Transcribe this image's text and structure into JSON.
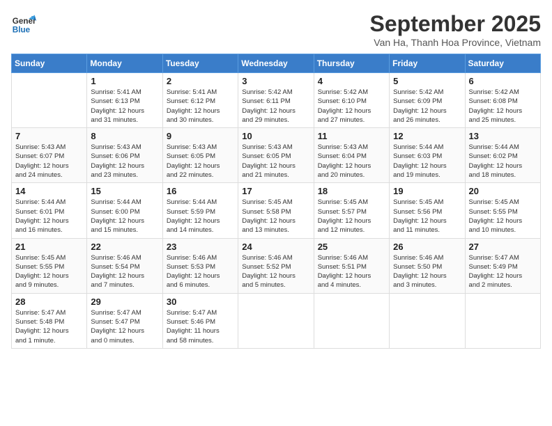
{
  "header": {
    "logo_line1": "General",
    "logo_line2": "Blue",
    "month": "September 2025",
    "location": "Van Ha, Thanh Hoa Province, Vietnam"
  },
  "weekdays": [
    "Sunday",
    "Monday",
    "Tuesday",
    "Wednesday",
    "Thursday",
    "Friday",
    "Saturday"
  ],
  "weeks": [
    [
      {
        "day": "",
        "info": ""
      },
      {
        "day": "1",
        "info": "Sunrise: 5:41 AM\nSunset: 6:13 PM\nDaylight: 12 hours\nand 31 minutes."
      },
      {
        "day": "2",
        "info": "Sunrise: 5:41 AM\nSunset: 6:12 PM\nDaylight: 12 hours\nand 30 minutes."
      },
      {
        "day": "3",
        "info": "Sunrise: 5:42 AM\nSunset: 6:11 PM\nDaylight: 12 hours\nand 29 minutes."
      },
      {
        "day": "4",
        "info": "Sunrise: 5:42 AM\nSunset: 6:10 PM\nDaylight: 12 hours\nand 27 minutes."
      },
      {
        "day": "5",
        "info": "Sunrise: 5:42 AM\nSunset: 6:09 PM\nDaylight: 12 hours\nand 26 minutes."
      },
      {
        "day": "6",
        "info": "Sunrise: 5:42 AM\nSunset: 6:08 PM\nDaylight: 12 hours\nand 25 minutes."
      }
    ],
    [
      {
        "day": "7",
        "info": "Sunrise: 5:43 AM\nSunset: 6:07 PM\nDaylight: 12 hours\nand 24 minutes."
      },
      {
        "day": "8",
        "info": "Sunrise: 5:43 AM\nSunset: 6:06 PM\nDaylight: 12 hours\nand 23 minutes."
      },
      {
        "day": "9",
        "info": "Sunrise: 5:43 AM\nSunset: 6:05 PM\nDaylight: 12 hours\nand 22 minutes."
      },
      {
        "day": "10",
        "info": "Sunrise: 5:43 AM\nSunset: 6:05 PM\nDaylight: 12 hours\nand 21 minutes."
      },
      {
        "day": "11",
        "info": "Sunrise: 5:43 AM\nSunset: 6:04 PM\nDaylight: 12 hours\nand 20 minutes."
      },
      {
        "day": "12",
        "info": "Sunrise: 5:44 AM\nSunset: 6:03 PM\nDaylight: 12 hours\nand 19 minutes."
      },
      {
        "day": "13",
        "info": "Sunrise: 5:44 AM\nSunset: 6:02 PM\nDaylight: 12 hours\nand 18 minutes."
      }
    ],
    [
      {
        "day": "14",
        "info": "Sunrise: 5:44 AM\nSunset: 6:01 PM\nDaylight: 12 hours\nand 16 minutes."
      },
      {
        "day": "15",
        "info": "Sunrise: 5:44 AM\nSunset: 6:00 PM\nDaylight: 12 hours\nand 15 minutes."
      },
      {
        "day": "16",
        "info": "Sunrise: 5:44 AM\nSunset: 5:59 PM\nDaylight: 12 hours\nand 14 minutes."
      },
      {
        "day": "17",
        "info": "Sunrise: 5:45 AM\nSunset: 5:58 PM\nDaylight: 12 hours\nand 13 minutes."
      },
      {
        "day": "18",
        "info": "Sunrise: 5:45 AM\nSunset: 5:57 PM\nDaylight: 12 hours\nand 12 minutes."
      },
      {
        "day": "19",
        "info": "Sunrise: 5:45 AM\nSunset: 5:56 PM\nDaylight: 12 hours\nand 11 minutes."
      },
      {
        "day": "20",
        "info": "Sunrise: 5:45 AM\nSunset: 5:55 PM\nDaylight: 12 hours\nand 10 minutes."
      }
    ],
    [
      {
        "day": "21",
        "info": "Sunrise: 5:45 AM\nSunset: 5:55 PM\nDaylight: 12 hours\nand 9 minutes."
      },
      {
        "day": "22",
        "info": "Sunrise: 5:46 AM\nSunset: 5:54 PM\nDaylight: 12 hours\nand 7 minutes."
      },
      {
        "day": "23",
        "info": "Sunrise: 5:46 AM\nSunset: 5:53 PM\nDaylight: 12 hours\nand 6 minutes."
      },
      {
        "day": "24",
        "info": "Sunrise: 5:46 AM\nSunset: 5:52 PM\nDaylight: 12 hours\nand 5 minutes."
      },
      {
        "day": "25",
        "info": "Sunrise: 5:46 AM\nSunset: 5:51 PM\nDaylight: 12 hours\nand 4 minutes."
      },
      {
        "day": "26",
        "info": "Sunrise: 5:46 AM\nSunset: 5:50 PM\nDaylight: 12 hours\nand 3 minutes."
      },
      {
        "day": "27",
        "info": "Sunrise: 5:47 AM\nSunset: 5:49 PM\nDaylight: 12 hours\nand 2 minutes."
      }
    ],
    [
      {
        "day": "28",
        "info": "Sunrise: 5:47 AM\nSunset: 5:48 PM\nDaylight: 12 hours\nand 1 minute."
      },
      {
        "day": "29",
        "info": "Sunrise: 5:47 AM\nSunset: 5:47 PM\nDaylight: 12 hours\nand 0 minutes."
      },
      {
        "day": "30",
        "info": "Sunrise: 5:47 AM\nSunset: 5:46 PM\nDaylight: 11 hours\nand 58 minutes."
      },
      {
        "day": "",
        "info": ""
      },
      {
        "day": "",
        "info": ""
      },
      {
        "day": "",
        "info": ""
      },
      {
        "day": "",
        "info": ""
      }
    ]
  ]
}
